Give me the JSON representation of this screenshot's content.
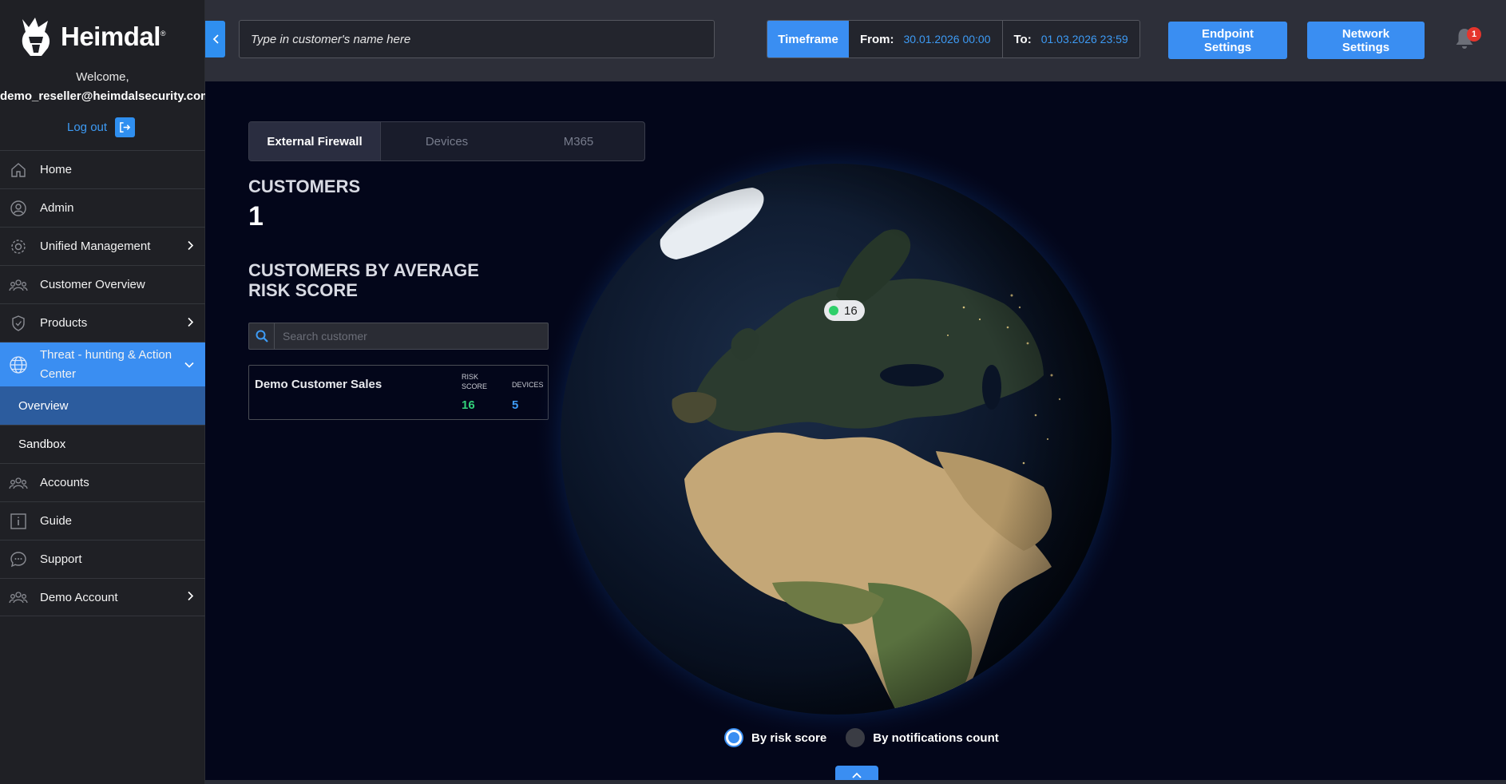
{
  "brand": {
    "name": "Heimdal",
    "mark": "®"
  },
  "user": {
    "welcome": "Welcome,",
    "email": "demo_reseller@heimdalsecurity.com",
    "logout_label": "Log out"
  },
  "sidebar": {
    "items": [
      {
        "label": "Home",
        "icon": "home-icon"
      },
      {
        "label": "Admin",
        "icon": "admin-shield-icon"
      },
      {
        "label": "Unified Management",
        "icon": "gear-icon"
      },
      {
        "label": "Customer Overview",
        "icon": "users-icon"
      },
      {
        "label": "Products",
        "icon": "shield-check-icon"
      },
      {
        "label": "Threat - hunting & Action Center",
        "icon": "globe-icon"
      },
      {
        "label": "Accounts",
        "icon": "users-icon"
      },
      {
        "label": "Guide",
        "icon": "info-icon"
      },
      {
        "label": "Support",
        "icon": "chat-icon"
      },
      {
        "label": "Demo Account",
        "icon": "users-icon"
      }
    ],
    "sub_items": [
      {
        "label": "Overview"
      },
      {
        "label": "Sandbox"
      }
    ]
  },
  "topbar": {
    "customer_placeholder": "Type in customer's name here",
    "timeframe_label": "Timeframe",
    "from_label": "From:",
    "from_value": "30.01.2026 00:00",
    "to_label": "To:",
    "to_value": "01.03.2026 23:59",
    "endpoint_settings": "Endpoint Settings",
    "network_settings": "Network Settings",
    "notification_count": "1"
  },
  "main": {
    "tabs": [
      {
        "label": "External Firewall"
      },
      {
        "label": "Devices"
      },
      {
        "label": "M365"
      }
    ],
    "customers_heading": "CUSTOMERS",
    "customers_count": "1",
    "risk_heading": "CUSTOMERS BY AVERAGE RISK SCORE",
    "search_placeholder": "Search customer",
    "customer_card": {
      "name": "Demo Customer Sales",
      "risk_header_1": "RISK",
      "risk_header_2": "SCORE",
      "devices_header": "DEVICES",
      "risk_value": "16",
      "devices_value": "5"
    },
    "map_marker": {
      "value": "16",
      "status_color": "#2fcf6a"
    },
    "view_options": [
      {
        "label": "By risk score",
        "selected": true
      },
      {
        "label": "By notifications count",
        "selected": false
      }
    ]
  },
  "colors": {
    "accent": "#3a8ef2",
    "sidebar_bg": "#1f2025",
    "topbar_bg": "#2d2f39",
    "main_bg": "#03061a",
    "risk_green": "#32d17a",
    "badge_red": "#e5352c"
  }
}
